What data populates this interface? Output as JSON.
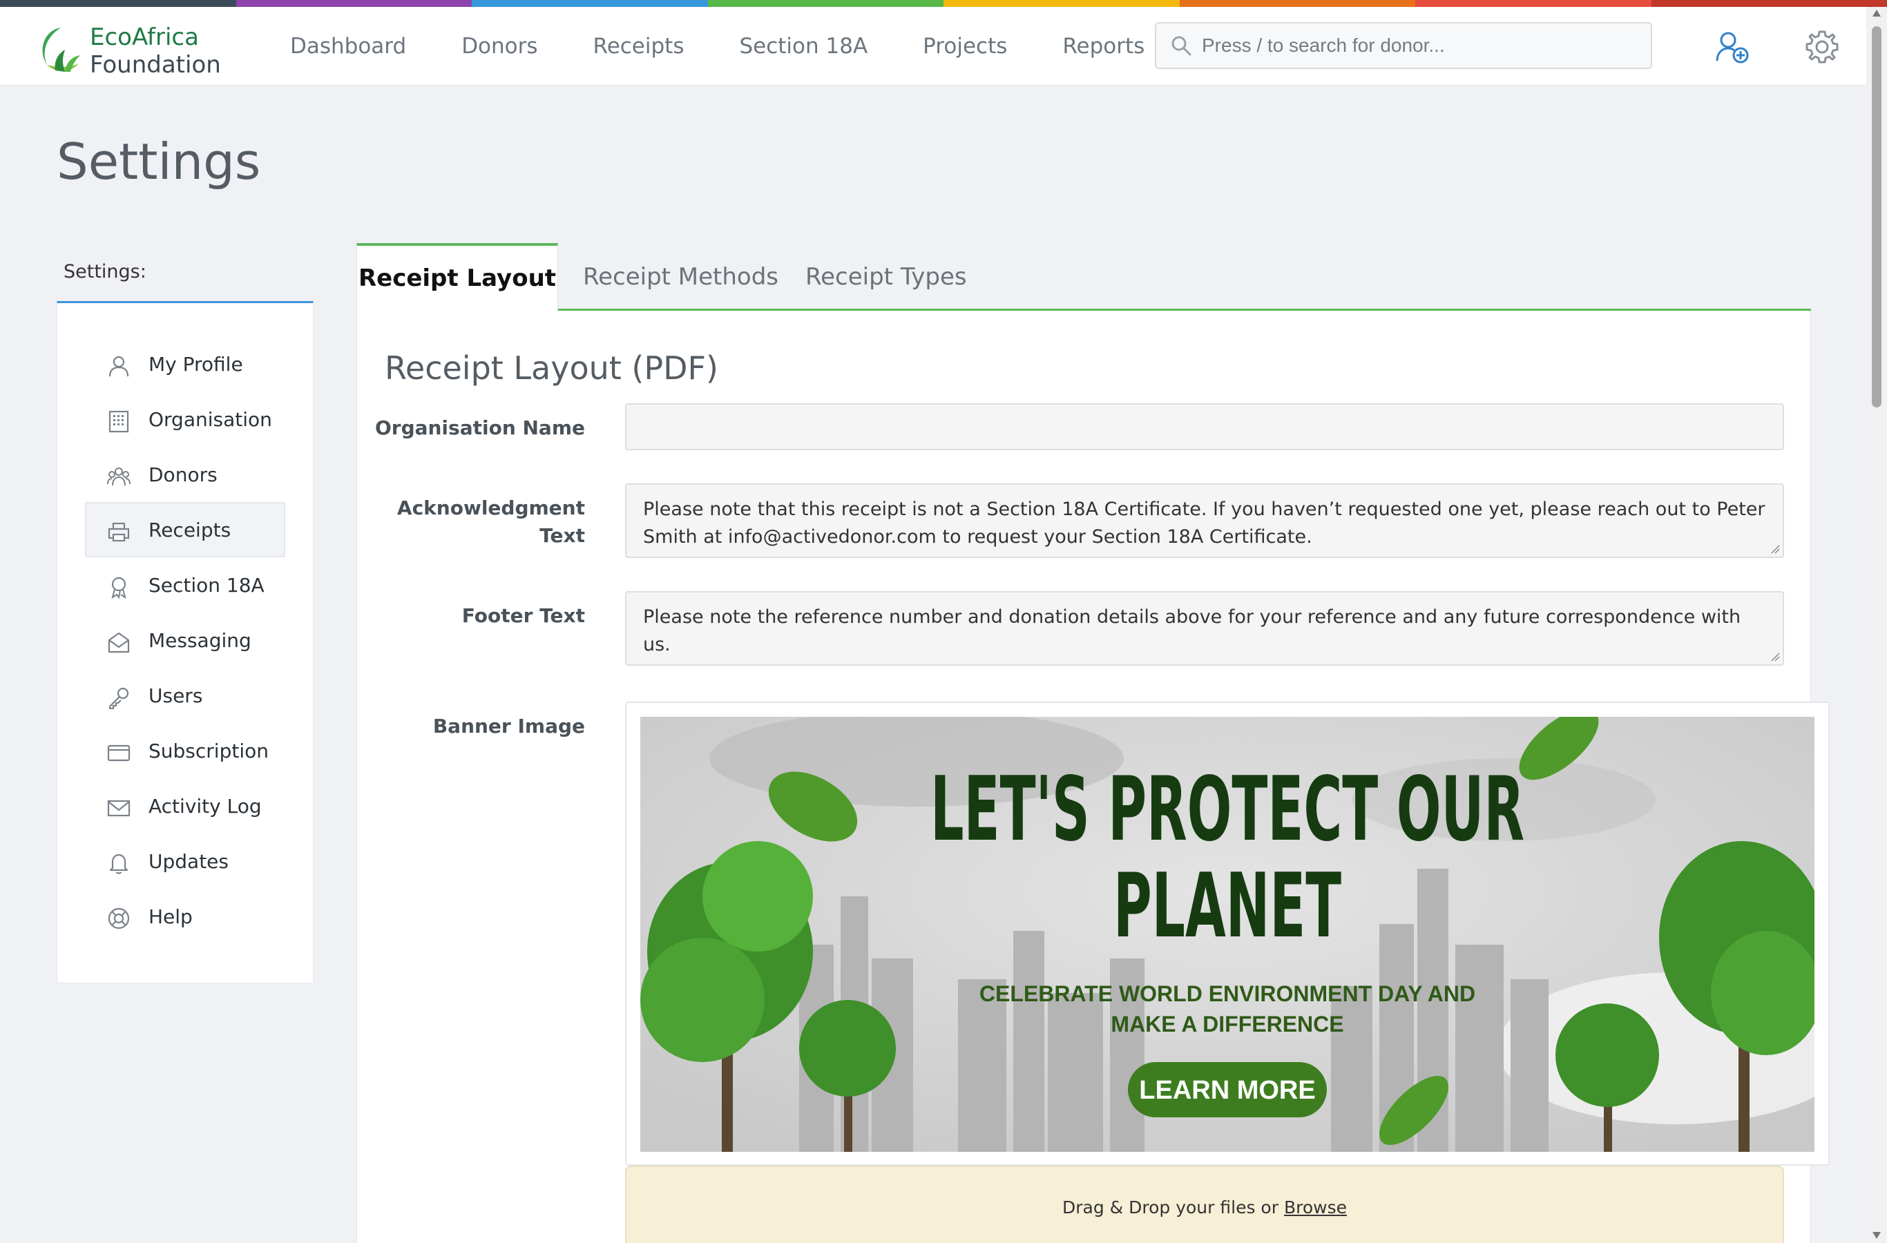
{
  "colors": {
    "topbar": [
      "#3d4a57",
      "#8e44ad",
      "#3498db",
      "#56b849",
      "#f5b90d",
      "#e8711c",
      "#e84c3d",
      "#c0392b"
    ],
    "accent_green": "#5cb85c",
    "sidebar_accent": "#3b93d8",
    "dropzone_bg": "#f7efd6"
  },
  "brand": {
    "line1": "EcoAfrica",
    "line2": "Foundation",
    "logo_icon": "leaf-logo-icon"
  },
  "nav": {
    "items": [
      {
        "label": "Dashboard"
      },
      {
        "label": "Donors"
      },
      {
        "label": "Receipts"
      },
      {
        "label": "Section 18A"
      },
      {
        "label": "Projects"
      },
      {
        "label": "Reports"
      }
    ]
  },
  "search": {
    "placeholder": "Press / to search for donor..."
  },
  "header_icons": {
    "add_user": "add-user-icon",
    "settings": "gear-icon"
  },
  "page": {
    "title": "Settings"
  },
  "sidebar": {
    "label": "Settings:",
    "items": [
      {
        "label": "My Profile",
        "icon": "user-icon"
      },
      {
        "label": "Organisation",
        "icon": "building-icon"
      },
      {
        "label": "Donors",
        "icon": "group-icon"
      },
      {
        "label": "Receipts",
        "icon": "printer-icon",
        "active": true
      },
      {
        "label": "Section 18A",
        "icon": "award-icon"
      },
      {
        "label": "Messaging",
        "icon": "envelope-open-icon"
      },
      {
        "label": "Users",
        "icon": "key-icon"
      },
      {
        "label": "Subscription",
        "icon": "credit-card-icon"
      },
      {
        "label": "Activity Log",
        "icon": "mail-icon"
      },
      {
        "label": "Updates",
        "icon": "bell-icon"
      },
      {
        "label": "Help",
        "icon": "lifebuoy-icon"
      }
    ]
  },
  "tabs": [
    {
      "label": "Receipt Layout",
      "active": true
    },
    {
      "label": "Receipt Methods"
    },
    {
      "label": "Receipt Types"
    }
  ],
  "form": {
    "section_title": "Receipt Layout (PDF)",
    "org_name": {
      "label": "Organisation Name",
      "value": ""
    },
    "ack_text": {
      "label_line1": "Acknowledgment",
      "label_line2": "Text",
      "value": "Please note that this receipt is not a Section 18A Certificate. If you haven’t requested one yet, please reach out to Peter Smith at info@activedonor.com  to request your Section 18A Certificate."
    },
    "footer_text": {
      "label": "Footer Text",
      "value": "Please note the reference number and donation details above for your reference and any future correspondence with us."
    },
    "banner": {
      "label": "Banner Image",
      "headline_line1": "LET'S PROTECT OUR",
      "headline_line2": "PLANET",
      "sub_line1": "CELEBRATE WORLD ENVIRONMENT DAY AND",
      "sub_line2": "MAKE A DIFFERENCE",
      "cta": "LEARN MORE"
    },
    "dropzone": {
      "text": "Drag & Drop your files or ",
      "link": "Browse"
    }
  }
}
